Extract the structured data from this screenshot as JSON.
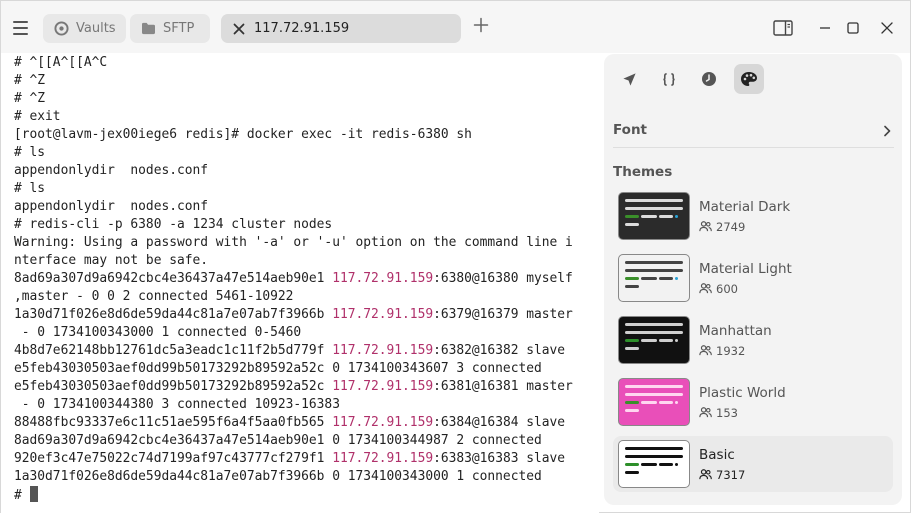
{
  "tabs": [
    {
      "label": "Vaults",
      "icon": "vault-icon"
    },
    {
      "label": "SFTP",
      "icon": "folder-icon"
    },
    {
      "label": "117.72.91.159",
      "icon": "close-icon",
      "active": true
    }
  ],
  "terminal": {
    "lines": [
      [
        {
          "t": "# ^[[A^[[A^C"
        }
      ],
      [
        {
          "t": "# ^Z"
        }
      ],
      [
        {
          "t": "# ^Z"
        }
      ],
      [
        {
          "t": "# exit"
        }
      ],
      [
        {
          "t": "[root@lavm-jex00iege6 redis]# docker exec -it redis-6380 sh"
        }
      ],
      [
        {
          "t": "# ls"
        }
      ],
      [
        {
          "t": "appendonlydir  nodes.conf"
        }
      ],
      [
        {
          "t": "# ls"
        }
      ],
      [
        {
          "t": "appendonlydir  nodes.conf"
        }
      ],
      [
        {
          "t": "# redis-cli -p 6380 -a 1234 cluster nodes"
        }
      ],
      [
        {
          "t": "Warning: Using a password with '-a' or '-u' option on the command line i"
        }
      ],
      [
        {
          "t": "nterface may not be safe."
        }
      ],
      [
        {
          "t": "8ad69a307d9a6942cbc4e36437a47e514aeb90e1 "
        },
        {
          "t": "117.72.91.159",
          "ip": true
        },
        {
          "t": ":6380@16380 myself"
        }
      ],
      [
        {
          "t": ",master - 0 0 2 connected 5461-10922"
        }
      ],
      [
        {
          "t": "1a30d71f026e8d6de59da44c81a7e07ab7f3966b "
        },
        {
          "t": "117.72.91.159",
          "ip": true
        },
        {
          "t": ":6379@16379 master"
        }
      ],
      [
        {
          "t": " - 0 1734100343000 1 connected 0-5460"
        }
      ],
      [
        {
          "t": "4b8d7e62148bb12761dc5a3eadc1c11f2b5d779f "
        },
        {
          "t": "117.72.91.159",
          "ip": true
        },
        {
          "t": ":6382@16382 slave"
        }
      ],
      [
        {
          "t": "e5feb43030503aef0dd99b50173292b89592a52c 0 1734100343607 3 connected"
        }
      ],
      [
        {
          "t": "e5feb43030503aef0dd99b50173292b89592a52c "
        },
        {
          "t": "117.72.91.159",
          "ip": true
        },
        {
          "t": ":6381@16381 master"
        }
      ],
      [
        {
          "t": " - 0 1734100344380 3 connected 10923-16383"
        }
      ],
      [
        {
          "t": "88488fbc93337e6c11c51ae595f6a4f5aa0fb565 "
        },
        {
          "t": "117.72.91.159",
          "ip": true
        },
        {
          "t": ":6384@16384 slave"
        }
      ],
      [
        {
          "t": "8ad69a307d9a6942cbc4e36437a47e514aeb90e1 0 1734100344987 2 connected"
        }
      ],
      [
        {
          "t": "920ef3c47e75022c74d7199af97c43777cf279f1 "
        },
        {
          "t": "117.72.91.159",
          "ip": true
        },
        {
          "t": ":6383@16383 slave"
        }
      ],
      [
        {
          "t": "1a30d71f026e8d6de59da44c81a7e07ab7f3966b 0 1734100343000 1 connected"
        }
      ]
    ],
    "prompt": "# ",
    "ip_color": "#b0306a"
  },
  "panel": {
    "tool_icons": [
      "rocket-icon",
      "braces-icon",
      "history-icon",
      "palette-icon"
    ],
    "active_tool": "palette-icon",
    "font_label": "Font",
    "themes_title": "Themes",
    "themes": [
      {
        "name": "Material Dark",
        "count": "2749",
        "bg": "#2b2b2b",
        "fg": "#dcdcdc",
        "accent": "#3a8f2a",
        "frame": "#3a3a3a"
      },
      {
        "name": "Material Light",
        "count": "600",
        "bg": "#f2f2f2",
        "fg": "#444444",
        "accent": "#3a8f2a",
        "frame": "#dcdcdc"
      },
      {
        "name": "Manhattan",
        "count": "1932",
        "bg": "#111111",
        "fg": "#cfcfcf",
        "accent": "#2d8f2a",
        "frame": "#222222"
      },
      {
        "name": "Plastic World",
        "count": "153",
        "bg": "#e94fb9",
        "fg": "#ffd6f0",
        "accent": "#3a8f2a",
        "frame": "#f06cc6"
      },
      {
        "name": "Basic",
        "count": "7317",
        "bg": "#ffffff",
        "fg": "#111111",
        "accent": "#2d8f2a",
        "frame": "#ffffff",
        "selected": true
      }
    ]
  }
}
